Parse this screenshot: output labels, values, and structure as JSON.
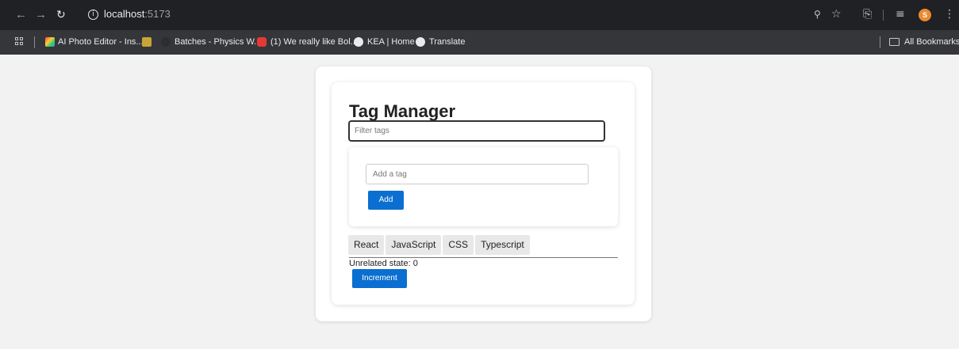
{
  "browser": {
    "url_host": "localhost",
    "url_port": ":5173",
    "avatar_initial": "S",
    "bookmarks": [
      {
        "label": "AI Photo Editor - Ins..."
      },
      {
        "label": "Batches - Physics W..."
      },
      {
        "label": "(1) We really like Bol..."
      },
      {
        "label": "KEA | Home"
      },
      {
        "label": "Translate"
      }
    ],
    "all_bookmarks_label": "All Bookmarks"
  },
  "app": {
    "title": "Tag Manager",
    "filter_placeholder": "Filter tags",
    "add_placeholder": "Add a tag",
    "add_label": "Add",
    "tags": [
      "React",
      "JavaScript",
      "CSS",
      "Typescript"
    ],
    "unrelated_state_label": "Unrelated state: 0",
    "increment_label": "Increment"
  }
}
